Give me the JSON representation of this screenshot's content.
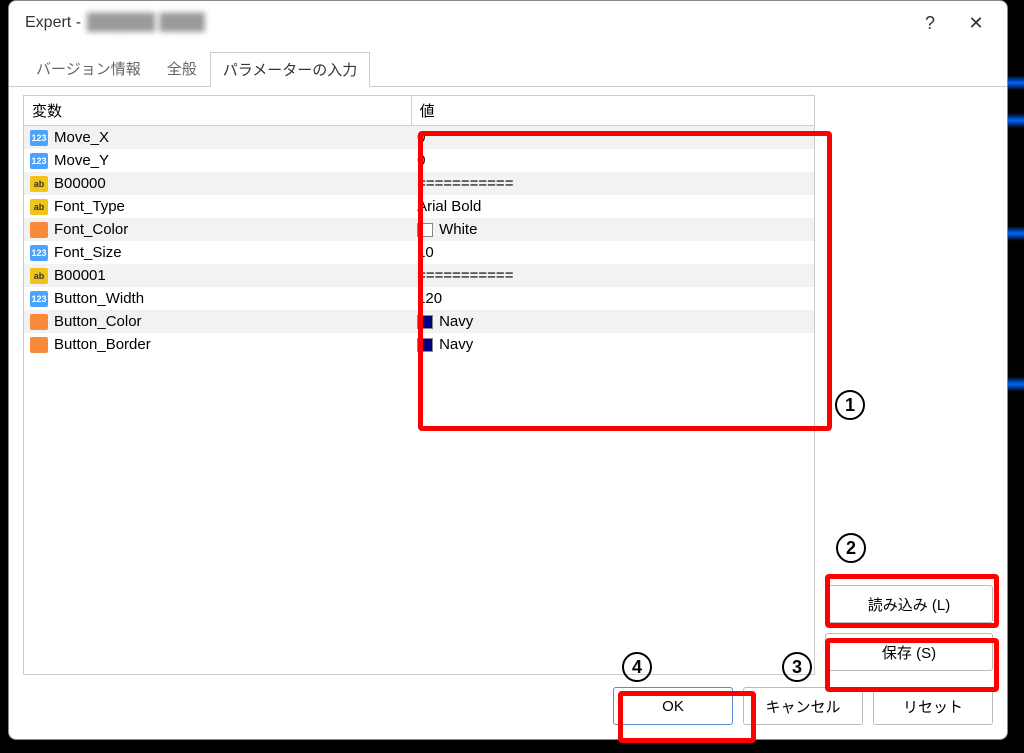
{
  "window": {
    "title_prefix": "Expert - ",
    "title_blur": "██████ ████"
  },
  "titlebar_buttons": {
    "help": "?",
    "close": "✕"
  },
  "tabs": [
    {
      "label": "バージョン情報"
    },
    {
      "label": "全般"
    },
    {
      "label": "パラメーターの入力"
    }
  ],
  "active_tab_index": 2,
  "columns": {
    "variable": "変数",
    "value": "値"
  },
  "rows": [
    {
      "type": "num",
      "name": "Move_X",
      "value": "0"
    },
    {
      "type": "num",
      "name": "Move_Y",
      "value": "0"
    },
    {
      "type": "str",
      "name": "B00000",
      "value": "==========="
    },
    {
      "type": "str",
      "name": "Font_Type",
      "value": "Arial Bold"
    },
    {
      "type": "col",
      "name": "Font_Color",
      "value": "White",
      "swatch": "#ffffff"
    },
    {
      "type": "num",
      "name": "Font_Size",
      "value": "10"
    },
    {
      "type": "str",
      "name": "B00001",
      "value": "==========="
    },
    {
      "type": "num",
      "name": "Button_Width",
      "value": "120"
    },
    {
      "type": "col",
      "name": "Button_Color",
      "value": "Navy",
      "swatch": "#000080"
    },
    {
      "type": "col",
      "name": "Button_Border",
      "value": "Navy",
      "swatch": "#000080"
    }
  ],
  "buttons": {
    "load": "読み込み (L)",
    "save": "保存 (S)",
    "ok": "OK",
    "cancel": "キャンセル",
    "reset": "リセット"
  },
  "annotations": {
    "a1": "1",
    "a2": "2",
    "a3": "3",
    "a4": "4"
  }
}
